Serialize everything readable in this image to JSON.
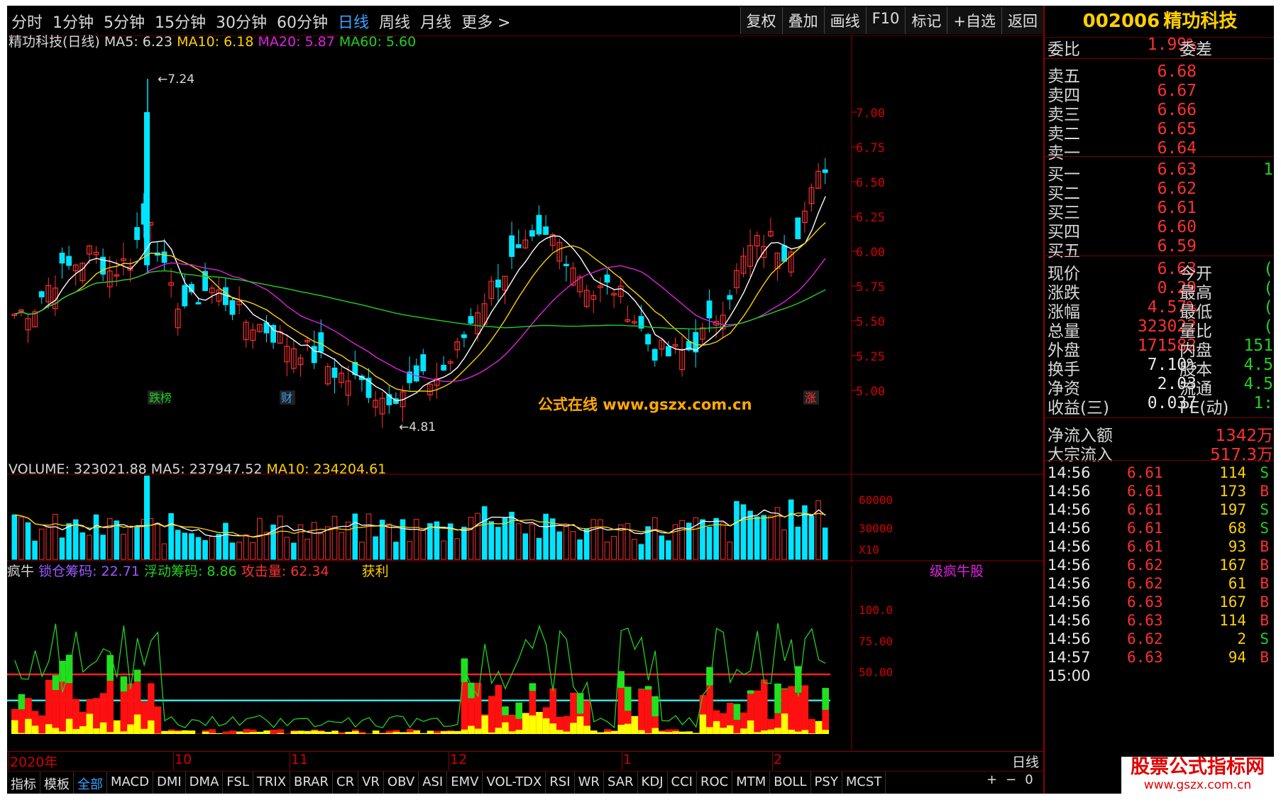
{
  "periods": [
    "分时",
    "1分钟",
    "5分钟",
    "15分钟",
    "30分钟",
    "60分钟",
    "日线",
    "周线",
    "月线",
    "更多 >"
  ],
  "active_period": "日线",
  "toolbar": [
    "复权",
    "叠加",
    "画线",
    "F10",
    "标记",
    "+自选",
    "返回"
  ],
  "kline_title": {
    "name": "精功科技(日线)",
    "ma5": "MA5: 6.23",
    "ma10": "MA10: 6.18",
    "ma20": "MA20: 5.87",
    "ma60": "MA60: 5.60"
  },
  "kline_axis": [
    "7.00",
    "6.75",
    "6.50",
    "6.25",
    "6.00",
    "5.75",
    "5.50",
    "5.25",
    "5.00"
  ],
  "kline_labels": {
    "high": "7.24",
    "low": "4.81",
    "badge1": "跌榜",
    "badge2": "财",
    "badge3": "涨"
  },
  "vol_title": {
    "volume": "VOLUME: 323021.88",
    "ma5": "MA5: 237947.52",
    "ma10": "MA10: 234204.61"
  },
  "vol_axis": [
    "60000",
    "30000",
    "X10"
  ],
  "ind_title": {
    "name": "疯牛",
    "lock": "锁仓筹码: 22.71",
    "float": "浮动筹码: 8.86",
    "attack": "攻击量: 62.34",
    "tail": "级疯牛股",
    "mid": "获利"
  },
  "ind_axis": [
    "100.0",
    "75.00",
    "50.00"
  ],
  "dates": [
    "2020年",
    "10",
    "11",
    "12",
    "1",
    "2"
  ],
  "period_tag": "日线",
  "watermark_center": "公式在线  www.gszx.com.cn",
  "watermark_corner": {
    "line1": "股票公式指标网",
    "line2": "www.gszx.com.cn"
  },
  "bottom_tabs": [
    "指标",
    "模板",
    "全部",
    "MACD",
    "DMI",
    "DMA",
    "FSL",
    "TRIX",
    "BRAR",
    "CR",
    "VR",
    "OBV",
    "ASI",
    "EMV",
    "VOL-TDX",
    "RSI",
    "WR",
    "SAR",
    "KDJ",
    "CCI",
    "ROC",
    "MTM",
    "BOLL",
    "PSY",
    "MCST"
  ],
  "bottom_active": "全部",
  "zoom_controls": [
    "+",
    "−",
    "0"
  ],
  "stock": {
    "code": "002006",
    "name": "精功科技"
  },
  "order_ratio": {
    "label": "委比",
    "value": "1.99%",
    "label2": "委差"
  },
  "asks": [
    {
      "l": "卖五",
      "p": "6.68"
    },
    {
      "l": "卖四",
      "p": "6.67"
    },
    {
      "l": "卖三",
      "p": "6.66"
    },
    {
      "l": "卖二",
      "p": "6.65"
    },
    {
      "l": "卖一",
      "p": "6.64"
    }
  ],
  "bids": [
    {
      "l": "买一",
      "p": "6.63",
      "q": "1"
    },
    {
      "l": "买二",
      "p": "6.62"
    },
    {
      "l": "买三",
      "p": "6.61"
    },
    {
      "l": "买四",
      "p": "6.60"
    },
    {
      "l": "买五",
      "p": "6.59"
    }
  ],
  "stats": [
    {
      "l": "现价",
      "v": "6.63",
      "l2": "今开",
      "v2": "("
    },
    {
      "l": "涨跌",
      "v": "0.29",
      "l2": "最高",
      "v2": "("
    },
    {
      "l": "涨幅",
      "v": "4.57%",
      "l2": "最低",
      "v2": "("
    },
    {
      "l": "总量",
      "v": "323022",
      "l2": "量比",
      "v2": "("
    },
    {
      "l": "外盘",
      "v": "171582",
      "l2": "内盘",
      "v2": "151"
    },
    {
      "l": "换手",
      "v": "7.10%",
      "l2": "股本",
      "v2": "4.5"
    },
    {
      "l": "净资",
      "v": "2.03",
      "l2": "流通",
      "v2": "4.5"
    },
    {
      "l": "收益(三)",
      "v": "0.037",
      "l2": "PE(动)",
      "v2": "1:"
    }
  ],
  "flows": [
    {
      "l": "净流入额",
      "v": "1342万"
    },
    {
      "l": "大宗流入",
      "v": "517.3万"
    }
  ],
  "ticks": [
    {
      "t": "14:56",
      "p": "6.61",
      "v": "114",
      "d": "S"
    },
    {
      "t": "14:56",
      "p": "6.61",
      "v": "173",
      "d": "B"
    },
    {
      "t": "14:56",
      "p": "6.61",
      "v": "197",
      "d": "S"
    },
    {
      "t": "14:56",
      "p": "6.61",
      "v": "68",
      "d": "S"
    },
    {
      "t": "14:56",
      "p": "6.61",
      "v": "93",
      "d": "B"
    },
    {
      "t": "14:56",
      "p": "6.62",
      "v": "167",
      "d": "B"
    },
    {
      "t": "14:56",
      "p": "6.62",
      "v": "61",
      "d": "B"
    },
    {
      "t": "14:56",
      "p": "6.63",
      "v": "167",
      "d": "B"
    },
    {
      "t": "14:56",
      "p": "6.63",
      "v": "114",
      "d": "B"
    },
    {
      "t": "14:56",
      "p": "6.62",
      "v": "2",
      "d": "S"
    },
    {
      "t": "14:57",
      "p": "6.63",
      "v": "94",
      "d": "B"
    },
    {
      "t": "15:00",
      "p": "",
      "v": "",
      "d": ""
    }
  ],
  "colors": {
    "up": "#ff3030",
    "down": "#00e5ff",
    "ma5": "#ffffff",
    "ma10": "#ffd000",
    "ma20": "#e020e0",
    "ma60": "#20d020"
  }
}
